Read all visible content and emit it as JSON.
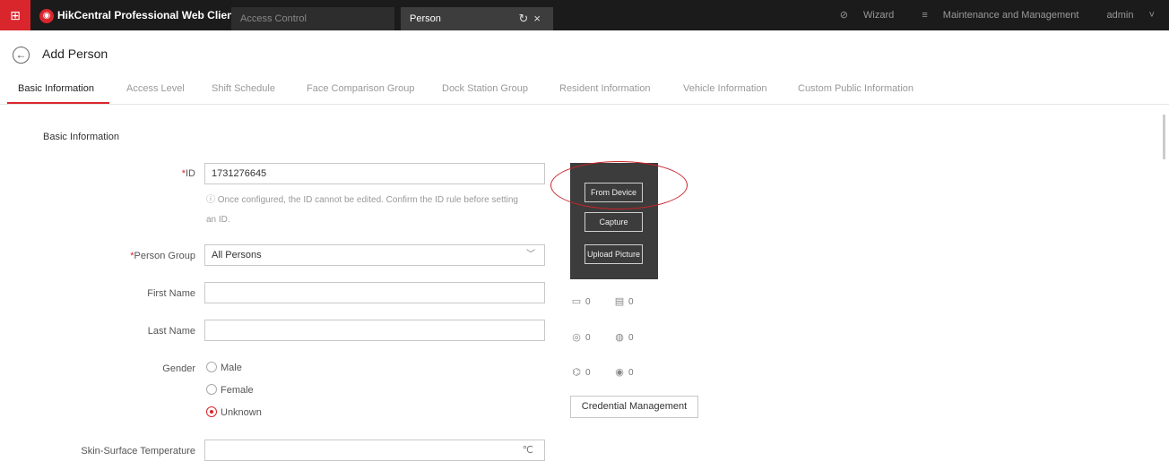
{
  "topbar": {
    "apps_icon": "apps-grid-icon",
    "brand": "HikCentral Professional Web Client",
    "tabs": [
      {
        "label": "Access Control"
      },
      {
        "label": "Person"
      }
    ],
    "wizard": "Wizard",
    "maintenance": "Maintenance and Management",
    "user": "admin",
    "colors": {
      "bar": "#1b1b1b",
      "accent": "#d9262c"
    }
  },
  "page": {
    "title": "Add Person"
  },
  "tabs": [
    {
      "label": "Basic Information"
    },
    {
      "label": "Access Level"
    },
    {
      "label": "Shift Schedule"
    },
    {
      "label": "Face Comparison Group"
    },
    {
      "label": "Dock Station Group"
    },
    {
      "label": "Resident Information"
    },
    {
      "label": "Vehicle Information"
    },
    {
      "label": "Custom Public Information"
    }
  ],
  "form": {
    "section_title": "Basic Information",
    "id_label": "ID",
    "id_value": "1731276645",
    "id_hint_line1": "Once configured, the ID cannot be edited. Confirm the ID rule before setting",
    "id_hint_line2": "an ID.",
    "person_group_label": "Person Group",
    "person_group_value": "All Persons",
    "first_name_label": "First Name",
    "first_name_value": "",
    "last_name_label": "Last Name",
    "last_name_value": "",
    "gender_label": "Gender",
    "gender_options": [
      {
        "label": "Male",
        "selected": false
      },
      {
        "label": "Female",
        "selected": false
      },
      {
        "label": "Unknown",
        "selected": true
      }
    ],
    "temperature_label": "Skin-Surface Temperature",
    "temperature_value": "",
    "temperature_unit": "℃"
  },
  "photo_panel": {
    "from_device": "From Device",
    "capture": "Capture",
    "upload_picture": "Upload Picture"
  },
  "credentials": {
    "card_count": "0",
    "card_reader_count": "0",
    "fingerprint_count": "0",
    "fingerprint_reader_count": "0",
    "face_count": "0",
    "iris_count": "0",
    "management_label": "Credential Management"
  }
}
